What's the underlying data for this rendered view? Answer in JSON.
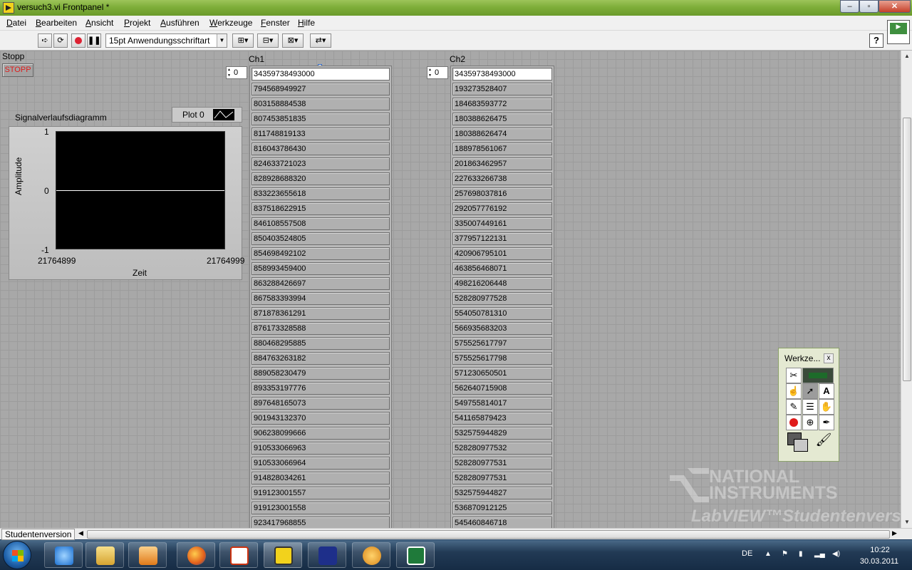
{
  "window": {
    "title": "versuch3.vi Frontpanel *",
    "minimize": "–",
    "maximize": "▫",
    "close": "✕"
  },
  "menu": [
    "Datei",
    "Bearbeiten",
    "Ansicht",
    "Projekt",
    "Ausführen",
    "Werkzeuge",
    "Fenster",
    "Hilfe"
  ],
  "toolbar": {
    "font": "15pt Anwendungsschriftart",
    "help": "?",
    "icons": [
      "run-arrow-icon",
      "run-continuously-icon",
      "abort-icon",
      "pause-icon",
      "align-icon",
      "distribute-icon",
      "resize-icon",
      "reorder-icon"
    ]
  },
  "vi_icon_text": "",
  "panel": {
    "stop": {
      "label": "Stopp",
      "button": "STOPP"
    },
    "graph": {
      "label": "Signalverlaufsdiagramm",
      "legend_plot": "Plot 0",
      "ylabel": "Amplitude",
      "xlabel": "Zeit",
      "y_ticks": [
        "1",
        "0",
        "-1"
      ],
      "x_min": "21764899",
      "x_max": "21764999"
    },
    "ch1": {
      "label": "Ch1",
      "index": "0",
      "values": [
        "34359738493000",
        "794568949927",
        "803158884538",
        "807453851835",
        "811748819133",
        "816043786430",
        "824633721023",
        "828928688320",
        "833223655618",
        "837518622915",
        "846108557508",
        "850403524805",
        "854698492102",
        "858993459400",
        "863288426697",
        "867583393994",
        "871878361291",
        "876173328588",
        "880468295885",
        "884763263182",
        "889058230479",
        "893353197776",
        "897648165073",
        "901943132370",
        "906238099666",
        "910533066963",
        "910533066964",
        "914828034261",
        "919123001557",
        "919123001558",
        "923417968855"
      ]
    },
    "ch2": {
      "label": "Ch2",
      "index": "0",
      "values": [
        "34359738493000",
        "193273528407",
        "184683593772",
        "180388626475",
        "180388626474",
        "188978561067",
        "201863462957",
        "227633266738",
        "257698037816",
        "292057776192",
        "335007449161",
        "377957122131",
        "420906795101",
        "463856468071",
        "498216206448",
        "528280977528",
        "554050781310",
        "566935683203",
        "575525617797",
        "575525617798",
        "571230650501",
        "562640715908",
        "549755814017",
        "541165879423",
        "532575944829",
        "528280977532",
        "528280977531",
        "528280977531",
        "532575944827",
        "536870912125",
        "545460846718"
      ]
    },
    "tools_palette": {
      "title": "Werkze...",
      "close": "x"
    },
    "watermark": {
      "line1": "NATIONAL",
      "line2": "INSTRUMENTS",
      "line3": "LabVIEW™Studentenversion"
    }
  },
  "statusbar": {
    "label": "Studentenversion"
  },
  "taskbar": {
    "apps": [
      "internet-explorer",
      "file-explorer",
      "media-player",
      "firefox",
      "pdf-reader",
      "labview",
      "signal-app",
      "gallery",
      "excel"
    ],
    "lang": "DE",
    "time": "10:22",
    "date": "30.03.2011"
  },
  "colors": {
    "titlebar": "#7fae3a",
    "panel": "#a8a8a8",
    "plot_bg": "#000000",
    "stop_text": "#e01b1b"
  }
}
